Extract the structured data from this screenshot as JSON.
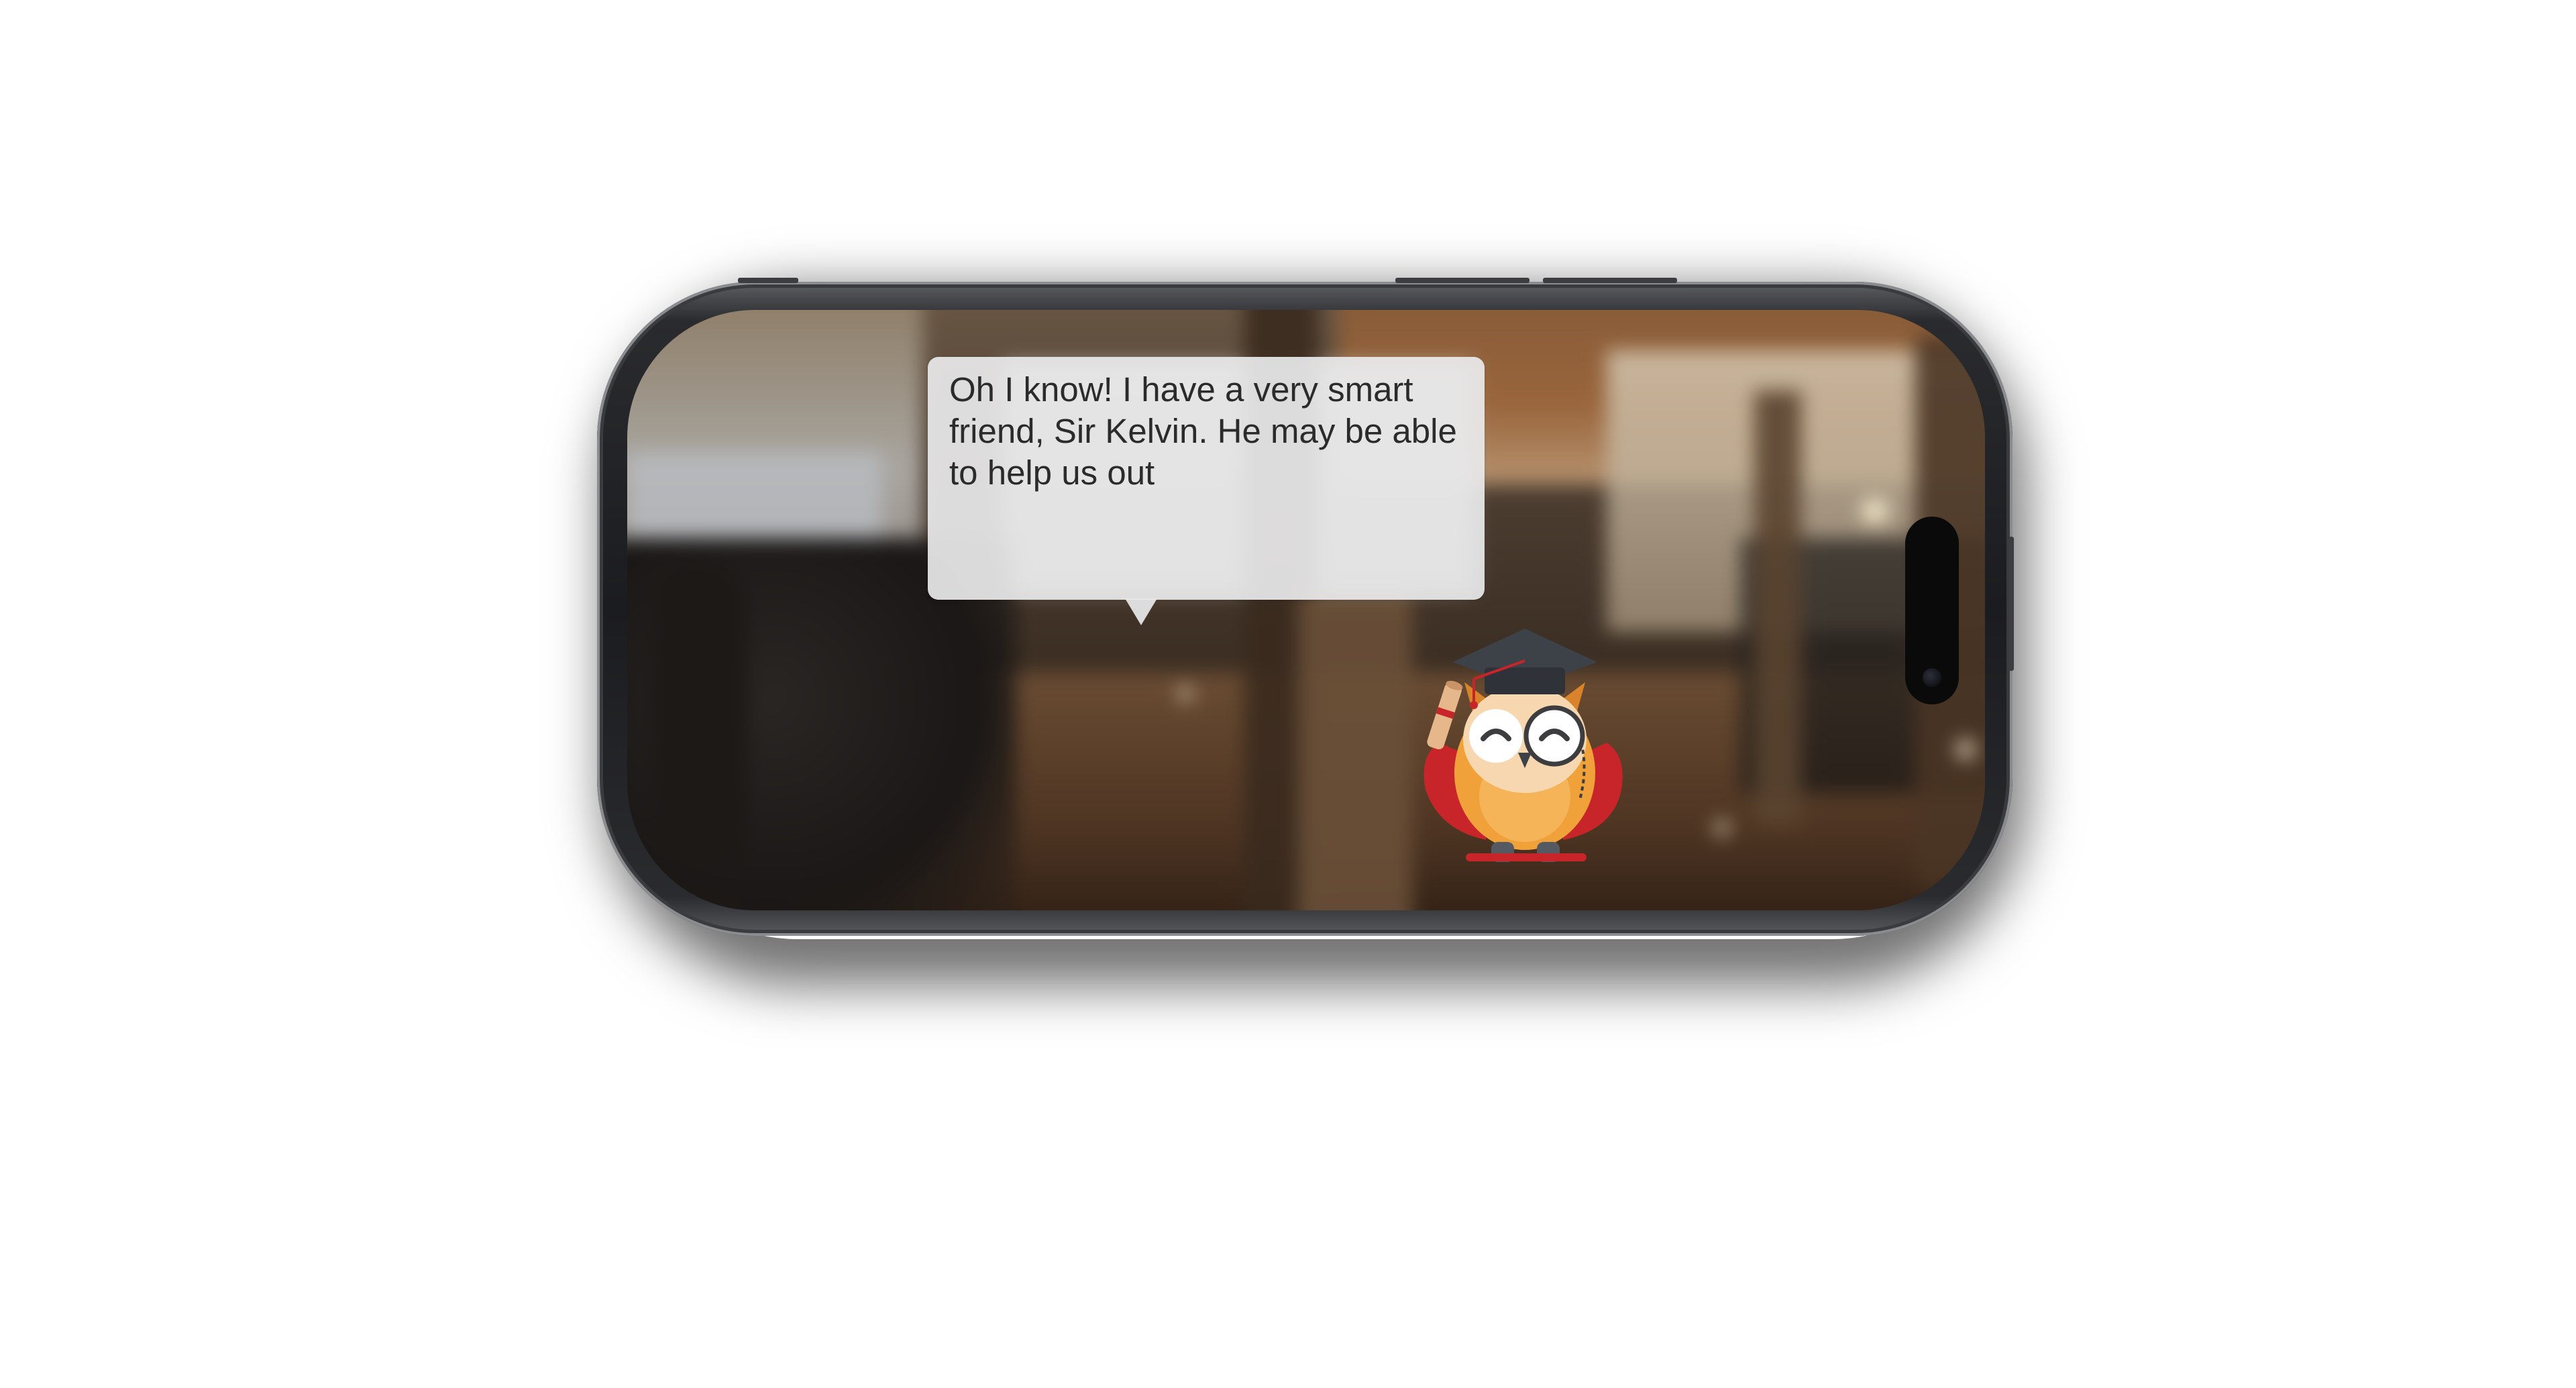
{
  "app": {
    "device": "phone-landscape"
  },
  "dialogue": {
    "text": "Oh I know! I have a very smart friend, Sir Kelvin. He may be able to help us out"
  },
  "character": {
    "icon": "owl-graduate-icon",
    "colors": {
      "body": "#f0a13a",
      "cape": "#c8252a",
      "cap": "#3d4148",
      "face": "#f6d7b0"
    }
  },
  "theme": {
    "bubble_bg": "#e8e8ea",
    "bubble_text": "#2b2b2b"
  }
}
